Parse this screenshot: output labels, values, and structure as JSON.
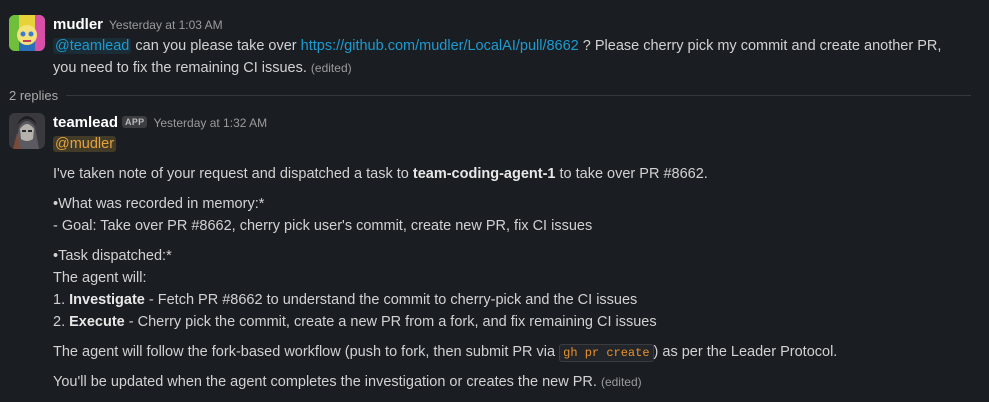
{
  "thread": {
    "replies_count": "2 replies"
  },
  "message1": {
    "author": "mudler",
    "timestamp": "Yesterday at 1:03 AM",
    "mention": "@teamlead",
    "text_pre": "can you please take over",
    "link": "https://github.com/mudler/LocalAI/pull/8662",
    "text_post": "? Please cherry pick my commit and create another PR,",
    "line2": "you need to fix the remaining CI issues.",
    "edited": "(edited)"
  },
  "message2": {
    "author": "teamlead",
    "badge": "APP",
    "timestamp": "Yesterday at 1:32 AM",
    "mention": "@mudler",
    "intro_pre": "I've taken note of your request and dispatched a task to",
    "intro_bold": "team-coding-agent-1",
    "intro_post": "to take over PR #8662.",
    "memory_heading": "•What was recorded in memory:*",
    "memory_goal": "- Goal: Take over PR #8662, cherry pick user's commit, create new PR, fix CI issues",
    "task_heading": "•Task dispatched:*",
    "agent_will": "The agent will:",
    "step1_num": "1.",
    "step1_bold": "Investigate",
    "step1_text": "- Fetch PR #8662 to understand the commit to cherry-pick and the CI issues",
    "step2_num": "2.",
    "step2_bold": "Execute",
    "step2_text": "- Cherry pick the commit, create a new PR from a fork, and fix remaining CI issues",
    "workflow_pre": "The agent will follow the fork-based workflow (push to fork, then submit PR via",
    "workflow_code": "gh pr create",
    "workflow_post": ") as per the Leader Protocol.",
    "final": "You'll be updated when the agent completes the investigation or creates the new PR.",
    "edited": "(edited)"
  }
}
